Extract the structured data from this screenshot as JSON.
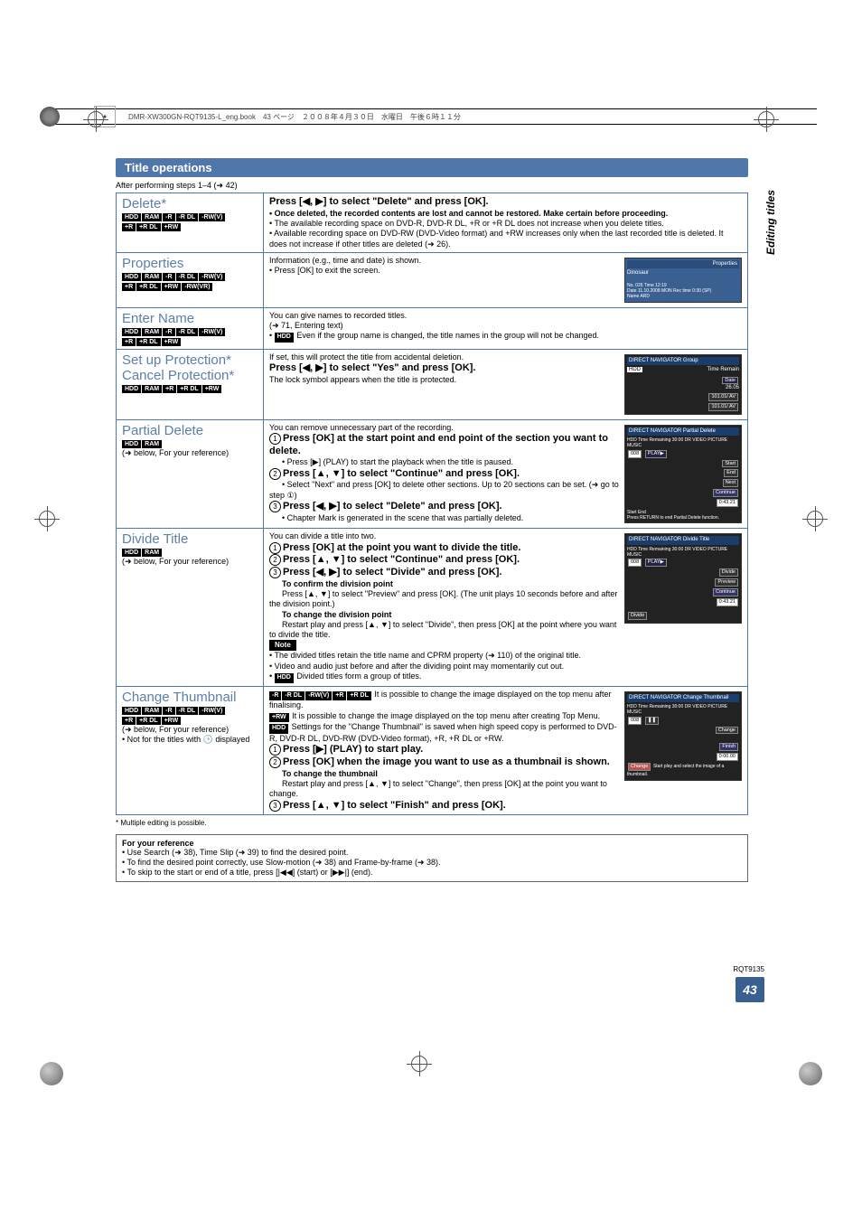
{
  "header": {
    "caption": "DMR-XW300GN-RQT9135-L_eng.book　43 ページ　２００８年４月３０日　水曜日　午後６時１１分"
  },
  "side_label": "Editing titles",
  "section_title": "Title operations",
  "after_steps": "After performing steps 1–4 (➜ 42)",
  "rows": {
    "delete": {
      "title": "Delete*",
      "badges": [
        "HDD",
        "RAM",
        "-R",
        "-R DL",
        "-RW(V)",
        "+R",
        "+R DL",
        "+RW"
      ],
      "body_bold": "Press [◀, ▶] to select \"Delete\" and press [OK].",
      "b1": "• Once deleted, the recorded contents are lost and cannot be restored. Make certain before proceeding.",
      "b2": "• The available recording space on DVD-R, DVD-R DL, +R or +R DL does not increase when you delete titles.",
      "b3": "• Available recording space on DVD-RW (DVD-Video format) and +RW increases only when the last recorded title is deleted. It does not increase if other titles are deleted (➜ 26)."
    },
    "properties": {
      "title": "Properties",
      "badges": [
        "HDD",
        "RAM",
        "-R",
        "-R DL",
        "-RW(V)",
        "+R",
        "+R DL",
        "+RW",
        "-RW(VR)"
      ],
      "b1": "Information (e.g., time and date) is shown.",
      "b2": "• Press [OK] to exit the screen.",
      "ss_title": "Properties",
      "ss_sub": "Dinosaur",
      "ss_l1": "No.   026               Time      12:19",
      "ss_l2": "Date  11.10.2008 MON Rec time 0:30 (SP)",
      "ss_l3": "Name  ARD"
    },
    "enter": {
      "title": "Enter Name",
      "badges": [
        "HDD",
        "RAM",
        "-R",
        "-R DL",
        "-RW(V)",
        "+R",
        "+R DL",
        "+RW"
      ],
      "b1": "You can give names to recorded titles.",
      "b2": "(➜ 71, Entering text)",
      "b3_pre": "• ",
      "b3_badge": "HDD",
      "b3_post": " Even if the group name is changed, the title names in the group will not be changed."
    },
    "protect": {
      "t1": "Set up Protection*",
      "t2": "Cancel Protection*",
      "badges": [
        "HDD",
        "RAM",
        "+R",
        "+R DL",
        "+RW"
      ],
      "b1": "If set, this will protect the title from accidental deletion.",
      "bold": "Press [◀, ▶] to select \"Yes\" and press [OK].",
      "b2": "The lock symbol appears when the title is protected.",
      "ss_head": "DIRECT NAVIGATOR   Group",
      "ss_hdd": "HDD",
      "ss_tr": "Time Remain",
      "ss_date": "Date",
      "ss_d1": "26.05",
      "ss_d2": "101.01/ AV",
      "ss_d3": "101.01/ AV"
    },
    "partial": {
      "title": "Partial Delete",
      "badges": [
        "HDD",
        "RAM"
      ],
      "ref": "(➜ below, For your reference)",
      "b1": "You can remove unnecessary part of the recording.",
      "s1": "Press [OK] at the start point and end point of the section you want to delete.",
      "s1b": "• Press [▶] (PLAY) to start the playback when the title is paused.",
      "s2": "Press [▲, ▼] to select \"Continue\" and press [OK].",
      "s2b": "• Select \"Next\" and press [OK] to delete other sections. Up to 20 sections can be set. (➜ go to step ①)",
      "s3": "Press [◀, ▶] to select \"Delete\" and press [OK].",
      "s3b": "• Chapter Mark is generated in the scene that was partially deleted.",
      "ss_head": "DIRECT NAVIGATOR   Partial Delete",
      "ss_sub": "HDD        Time Remaining 30:00 DR VIDEO PICTURE MUSIC",
      "ss_008": "008",
      "ss_play": "PLAY▶",
      "ss_btn1": "Start",
      "ss_btn2": "End",
      "ss_btn3": "Next",
      "ss_btn4": "Continue",
      "ss_time": "0:43.21",
      "ss_row1": "Start   End",
      "ss_foot": "Press RETURN to end Partial Delete function."
    },
    "divide": {
      "title": "Divide Title",
      "badges": [
        "HDD",
        "RAM"
      ],
      "ref": "(➜ below, For your reference)",
      "b1": "You can divide a title into two.",
      "s1": "Press [OK] at the point you want to divide the title.",
      "s2": "Press [▲, ▼] to select \"Continue\" and press [OK].",
      "s3": "Press [◀, ▶] to select \"Divide\" and press [OK].",
      "sub1": "To confirm the division point",
      "sub1b": "Press [▲, ▼] to select \"Preview\" and press [OK]. (The unit plays 10 seconds before and after the division point.)",
      "sub2": "To change the division point",
      "sub2b": "Restart play and press [▲, ▼] to select \"Divide\", then press [OK] at the point where you want to divide the title.",
      "note": "Note",
      "n1": "• The divided titles retain the title name and CPRM property (➜ 110) of the original title.",
      "n2": "• Video and audio just before and after the dividing point may momentarily cut out.",
      "n3_pre": "• ",
      "n3_badge": "HDD",
      "n3_post": " Divided titles form a group of titles.",
      "ss_head": "DIRECT NAVIGATOR   Divide Title",
      "ss_sub": "HDD        Time Remaining 30:00 DR VIDEO PICTURE MUSIC",
      "ss_008": "008",
      "ss_play": "PLAY▶",
      "ss_btn1": "Divide",
      "ss_btn2": "Preview",
      "ss_btn3": "Continue",
      "ss_time": "0:43.21",
      "ss_row": "Divide"
    },
    "thumb": {
      "title": "Change Thumbnail",
      "badges": [
        "HDD",
        "RAM",
        "-R",
        "-R DL",
        "-RW(V)",
        "+R",
        "+R DL",
        "+RW"
      ],
      "ref": "(➜ below, For your reference)",
      "note_icon": "• Not for the titles with 🕒 displayed",
      "line1_badges": [
        "-R",
        "-R DL",
        "-RW(V)",
        "+R",
        "+R DL"
      ],
      "line1": " It is possible to change the image displayed on the top menu after finalising.",
      "line2_badge": "+RW",
      "line2": " It is possible to change the image displayed on the top menu after creating Top Menu.",
      "line3_badge": "HDD",
      "line3": " Settings for the \"Change Thumbnail\" is saved when high speed copy is performed to DVD-R, DVD-R DL, DVD-RW (DVD-Video format), +R, +R DL or +RW.",
      "s1": "Press [▶] (PLAY) to start play.",
      "s2": "Press [OK] when the image you want to use as a thumbnail is shown.",
      "sub1": "To change the thumbnail",
      "sub1b": "Restart play and press [▲, ▼] to select \"Change\", then press [OK] at the point you want to change.",
      "s3": "Press [▲, ▼] to select \"Finish\" and press [OK].",
      "ss_head": "DIRECT NAVIGATOR Change Thumbnail",
      "ss_sub": "HDD        Time Remaining 30:00 DR VIDEO PICTURE MUSIC",
      "ss_008": "008",
      "ss_pause": "❚❚",
      "ss_btn1": "Change",
      "ss_btn2": "Finish",
      "ss_time": "0:00.00",
      "ss_ch": "Change",
      "ss_hint": "Start play and select the image of a thumbnail."
    }
  },
  "multi_note": "* Multiple editing is possible.",
  "ref": {
    "title": "For your reference",
    "l1": "• Use Search (➜ 38), Time Slip (➜ 39) to find the desired point.",
    "l2": "• To find the desired point correctly, use Slow-motion (➜ 38) and Frame-by-frame (➜ 38).",
    "l3": "• To skip to the start or end of a title, press [|◀◀] (start) or [▶▶|] (end)."
  },
  "rqt": "RQT9135",
  "page_num": "43"
}
